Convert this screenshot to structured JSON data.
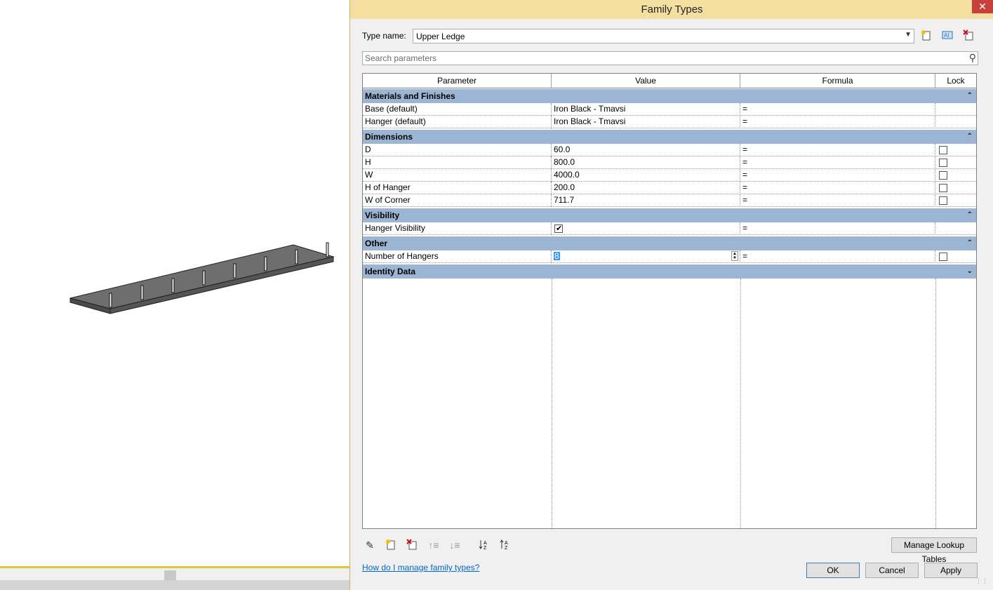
{
  "dialog": {
    "title": "Family Types",
    "close_glyph": "✕",
    "type_name_label": "Type name:",
    "type_name_value": "Upper Ledge",
    "search_placeholder": "Search parameters",
    "columns": [
      "Parameter",
      "Value",
      "Formula",
      "Lock"
    ],
    "groups": [
      {
        "name": "Materials and Finishes",
        "collapsed": false,
        "rows": [
          {
            "parameter": "Base (default)",
            "value": "Iron Black - Tmavsi",
            "formula": "=",
            "lock": null
          },
          {
            "parameter": "Hanger (default)",
            "value": "Iron Black - Tmavsi",
            "formula": "=",
            "lock": null
          }
        ]
      },
      {
        "name": "Dimensions",
        "collapsed": false,
        "rows": [
          {
            "parameter": "D",
            "value": "60.0",
            "formula": "=",
            "lock": false
          },
          {
            "parameter": "H",
            "value": "800.0",
            "formula": "=",
            "lock": false
          },
          {
            "parameter": "W",
            "value": "4000.0",
            "formula": "=",
            "lock": false
          },
          {
            "parameter": "H of Hanger",
            "value": "200.0",
            "formula": "=",
            "lock": false
          },
          {
            "parameter": "W of Corner",
            "value": "711.7",
            "formula": "=",
            "lock": false
          }
        ]
      },
      {
        "name": "Visibility",
        "collapsed": false,
        "rows": [
          {
            "parameter": "Hanger Visibility",
            "value_checkbox": true,
            "formula": "=",
            "lock": null
          }
        ]
      },
      {
        "name": "Other",
        "collapsed": false,
        "rows": [
          {
            "parameter": "Number of Hangers",
            "value": "8",
            "formula": "=",
            "lock": false
          }
        ]
      },
      {
        "name": "Identity Data",
        "collapsed": true,
        "rows": []
      }
    ],
    "manage_lookup_label": "Manage Lookup Tables",
    "help_link": "How do I manage family types?",
    "ok_label": "OK",
    "cancel_label": "Cancel",
    "apply_label": "Apply"
  },
  "colors": {
    "titlebar": "#f4dfa0",
    "group_header": "#9bb5d2",
    "close_button": "#c7413a",
    "status_line": "#e8c23a"
  },
  "icons": {
    "new_type": "new-type-icon",
    "rename_type": "rename-type-icon",
    "delete_type": "delete-type-icon",
    "search": "search-icon",
    "edit_parameter": "pencil-icon",
    "new_parameter": "new-parameter-icon",
    "delete_parameter": "delete-parameter-icon",
    "move_up": "move-up-icon",
    "move_down": "move-down-icon",
    "sort_ascending": "sort-ascending-icon",
    "sort_descending": "sort-descending-icon"
  }
}
